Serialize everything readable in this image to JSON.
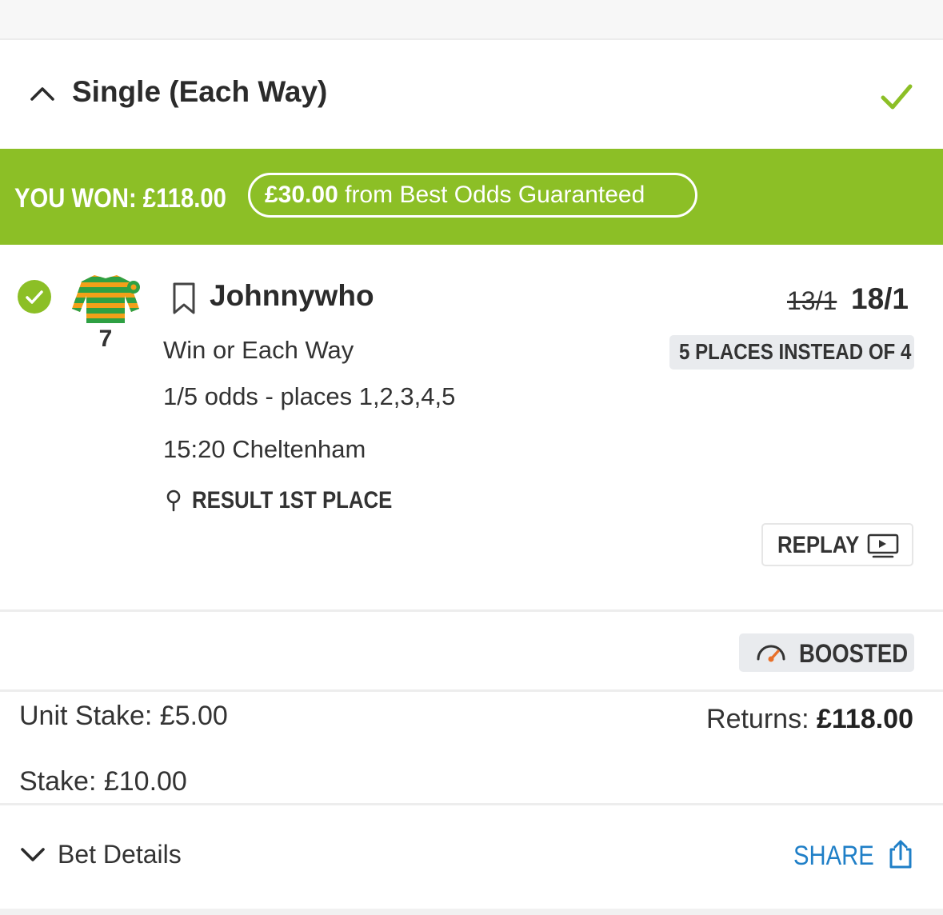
{
  "header": {
    "title": "Single (Each Way)",
    "status_icon": "check-icon",
    "accent_color": "#8cbf26"
  },
  "banner": {
    "won_text": "YOU WON: £118.00",
    "boost_amount": "£30.00",
    "boost_text": "from Best Odds Guaranteed",
    "color": "#8cbf26"
  },
  "selection": {
    "runner_name": "Johnnywho",
    "cloth_number": "7",
    "odds_original": "13/1",
    "odds_current": "18/1",
    "places_badge": "5 PLACES INSTEAD OF 4",
    "market": "Win or Each Way",
    "each_way_terms": "1/5 odds - places 1,2,3,4,5",
    "race": "15:20 Cheltenham",
    "result": "RESULT 1ST PLACE",
    "replay_label": "REPLAY"
  },
  "boost": {
    "label": "BOOSTED"
  },
  "stakes": {
    "unit_stake": "Unit Stake: £5.00",
    "total_stake": "Stake: £10.00",
    "returns_label": "Returns:",
    "returns_value": "£118.00"
  },
  "footer": {
    "bet_details_label": "Bet Details",
    "share_label": "SHARE",
    "link_color": "#1f7fc7"
  }
}
